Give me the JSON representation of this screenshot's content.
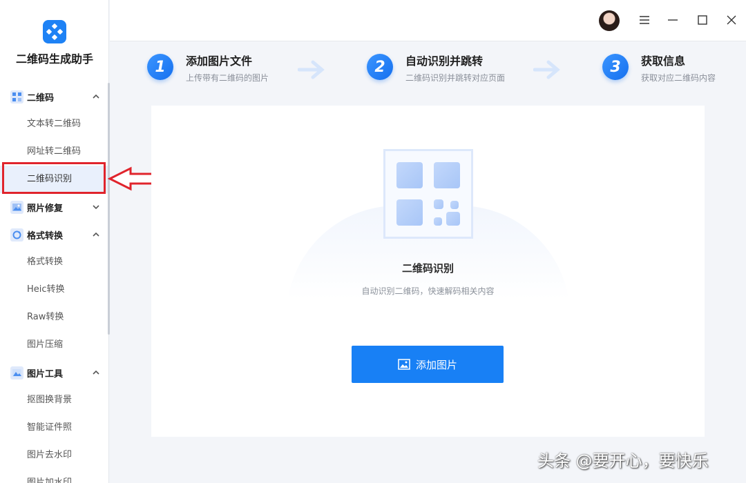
{
  "app": {
    "title": "二维码生成助手"
  },
  "sidebar": {
    "groups": [
      {
        "label": "二维码",
        "icon": "qr-grid-icon",
        "expanded": true,
        "items": [
          "文本转二维码",
          "网址转二维码",
          "二维码识别"
        ]
      },
      {
        "label": "照片修复",
        "icon": "photo-repair-icon",
        "expanded": false,
        "items": []
      },
      {
        "label": "格式转换",
        "icon": "convert-icon",
        "expanded": true,
        "items": [
          "格式转换",
          "Heic转换",
          "Raw转换",
          "图片压缩"
        ]
      },
      {
        "label": "图片工具",
        "icon": "image-tools-icon",
        "expanded": true,
        "items": [
          "抠图换背景",
          "智能证件照",
          "图片去水印",
          "图片加水印"
        ]
      }
    ],
    "active_item": "二维码识别"
  },
  "steps": [
    {
      "num": "1",
      "title": "添加图片文件",
      "desc": "上传带有二维码的图片"
    },
    {
      "num": "2",
      "title": "自动识别并跳转",
      "desc": "二维码识别并跳转对应页面"
    },
    {
      "num": "3",
      "title": "获取信息",
      "desc": "获取对应二维码内容"
    }
  ],
  "main": {
    "title": "二维码识别",
    "subtitle": "自动识别二维码，快速解码相关内容",
    "button_label": "添加图片"
  },
  "watermark": "头条 @要开心，要快乐",
  "colors": {
    "accent": "#1880f5",
    "annotation_red": "#e0242c"
  }
}
